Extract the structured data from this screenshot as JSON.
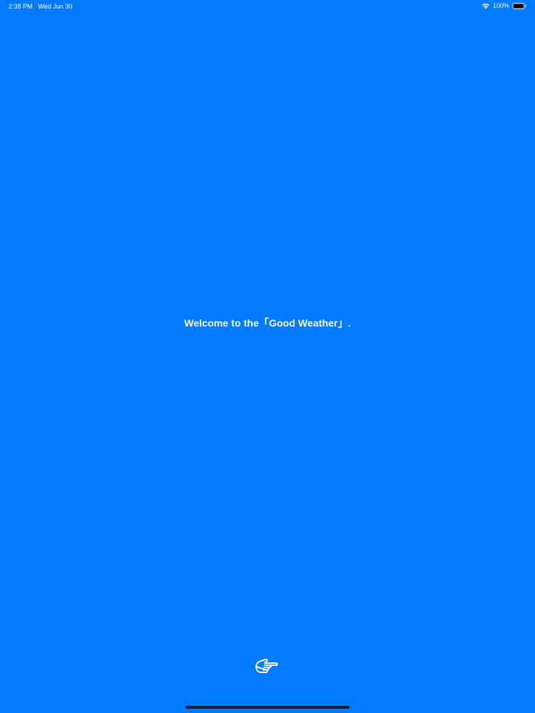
{
  "status_bar": {
    "time": "2:38 PM",
    "date": "Wed Jun 30",
    "battery_percent": "100%"
  },
  "main": {
    "welcome_text": "Welcome to the「Good Weather」."
  },
  "icons": {
    "start_button": "pointing-hand-icon",
    "wifi": "wifi-icon",
    "battery": "battery-icon"
  },
  "colors": {
    "background": "#007AFF",
    "text": "#FFFFFF",
    "home_indicator": "#1C1C1E"
  }
}
